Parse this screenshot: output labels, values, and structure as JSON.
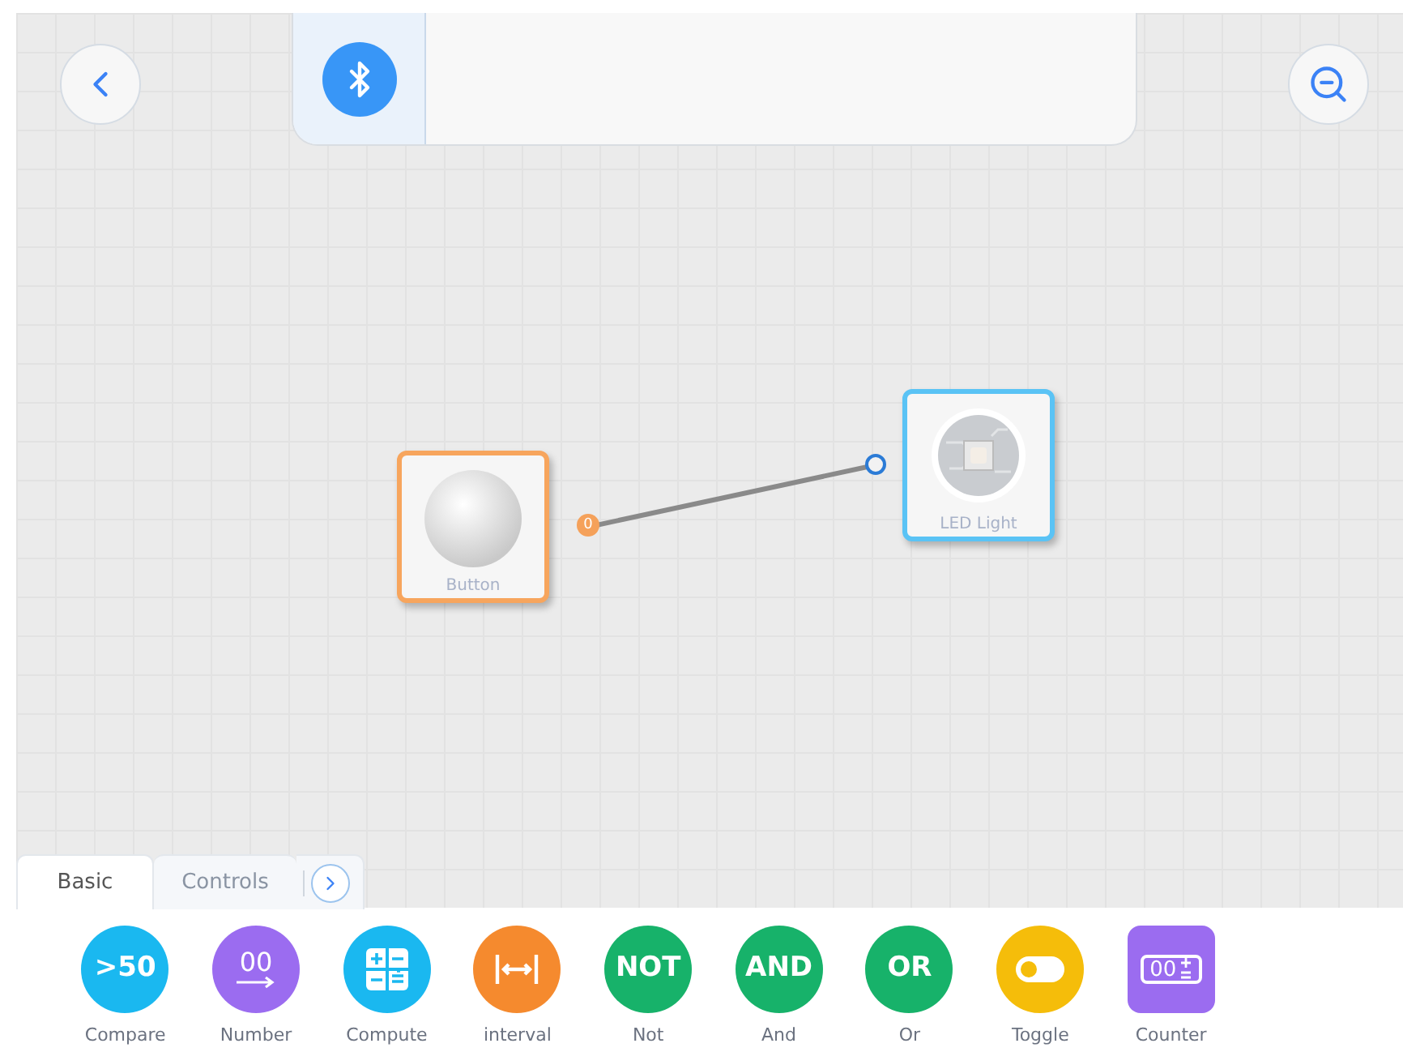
{
  "canvas": {
    "nodes": [
      {
        "kind": "button",
        "label": "Button",
        "port": "0"
      },
      {
        "kind": "led",
        "label": "LED Light"
      }
    ]
  },
  "tabs": [
    {
      "label": "Basic",
      "selected": true
    },
    {
      "label": "Controls",
      "selected": false
    }
  ],
  "palette": [
    {
      "kind": "text",
      "glyph": ">50",
      "label": "Compare",
      "color": "#1ab8f0"
    },
    {
      "kind": "number",
      "glyph": "00",
      "label": "Number",
      "color": "#9b6cf0"
    },
    {
      "kind": "compute",
      "label": "Compute",
      "color": "#1ab8f0"
    },
    {
      "kind": "interval",
      "label": "interval",
      "color": "#f58a2e"
    },
    {
      "kind": "text",
      "glyph": "NOT",
      "label": "Not",
      "color": "#17b26a"
    },
    {
      "kind": "text",
      "glyph": "AND",
      "label": "And",
      "color": "#17b26a"
    },
    {
      "kind": "text",
      "glyph": "OR",
      "label": "Or",
      "color": "#17b26a"
    },
    {
      "kind": "toggle",
      "label": "Toggle",
      "color": "#f5bd0a"
    },
    {
      "kind": "counter",
      "glyph": "00",
      "label": "Counter",
      "color": "#9b6cf0"
    }
  ]
}
